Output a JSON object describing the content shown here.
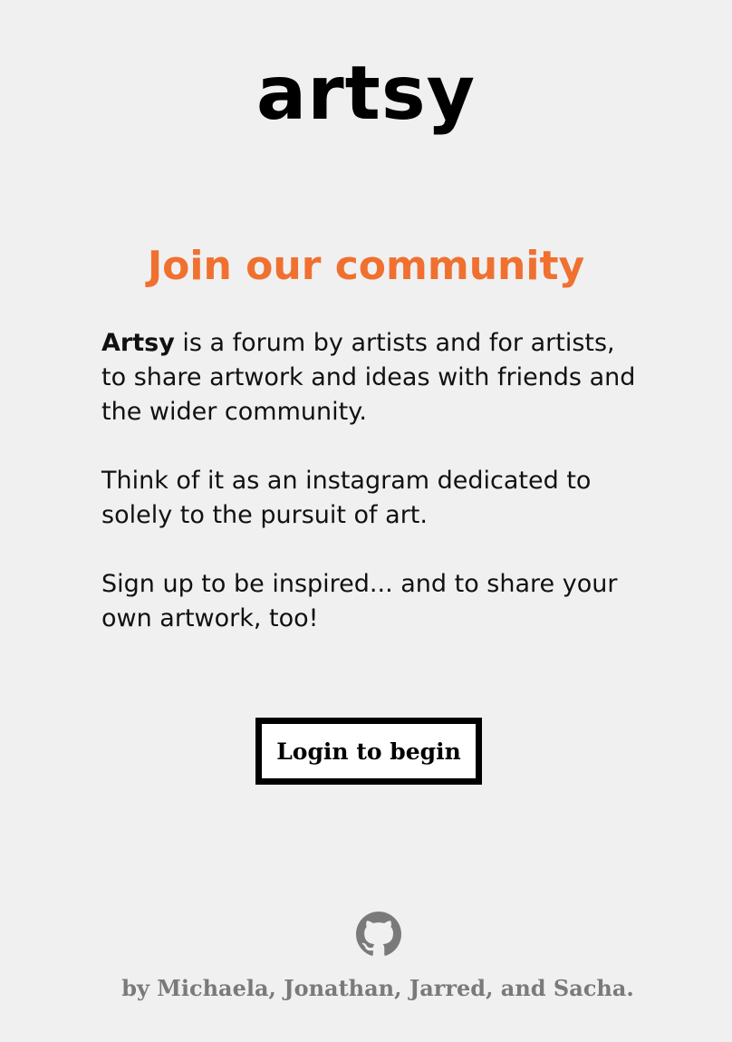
{
  "brand": {
    "logo_text": "artsy"
  },
  "hero": {
    "heading": "Join our community",
    "brand_name": "Artsy",
    "paragraph1_rest": " is a forum by artists and for artists, to share artwork and ideas with friends and the wider community.",
    "paragraph2": "Think of it as an instagram dedicated to solely to the pursuit of art.",
    "paragraph3": "Sign up to be inspired... and to share your own artwork, too!"
  },
  "actions": {
    "login_label": "Login to begin"
  },
  "footer": {
    "github_icon": "github-icon",
    "credits": "by Michaela, Jonathan, Jarred, and Sacha."
  },
  "colors": {
    "background": "#f0f0f0",
    "heading": "#f07030",
    "text": "#111111",
    "footer_text": "#7a7a7a",
    "button_border": "#000000",
    "button_bg": "#ffffff"
  }
}
